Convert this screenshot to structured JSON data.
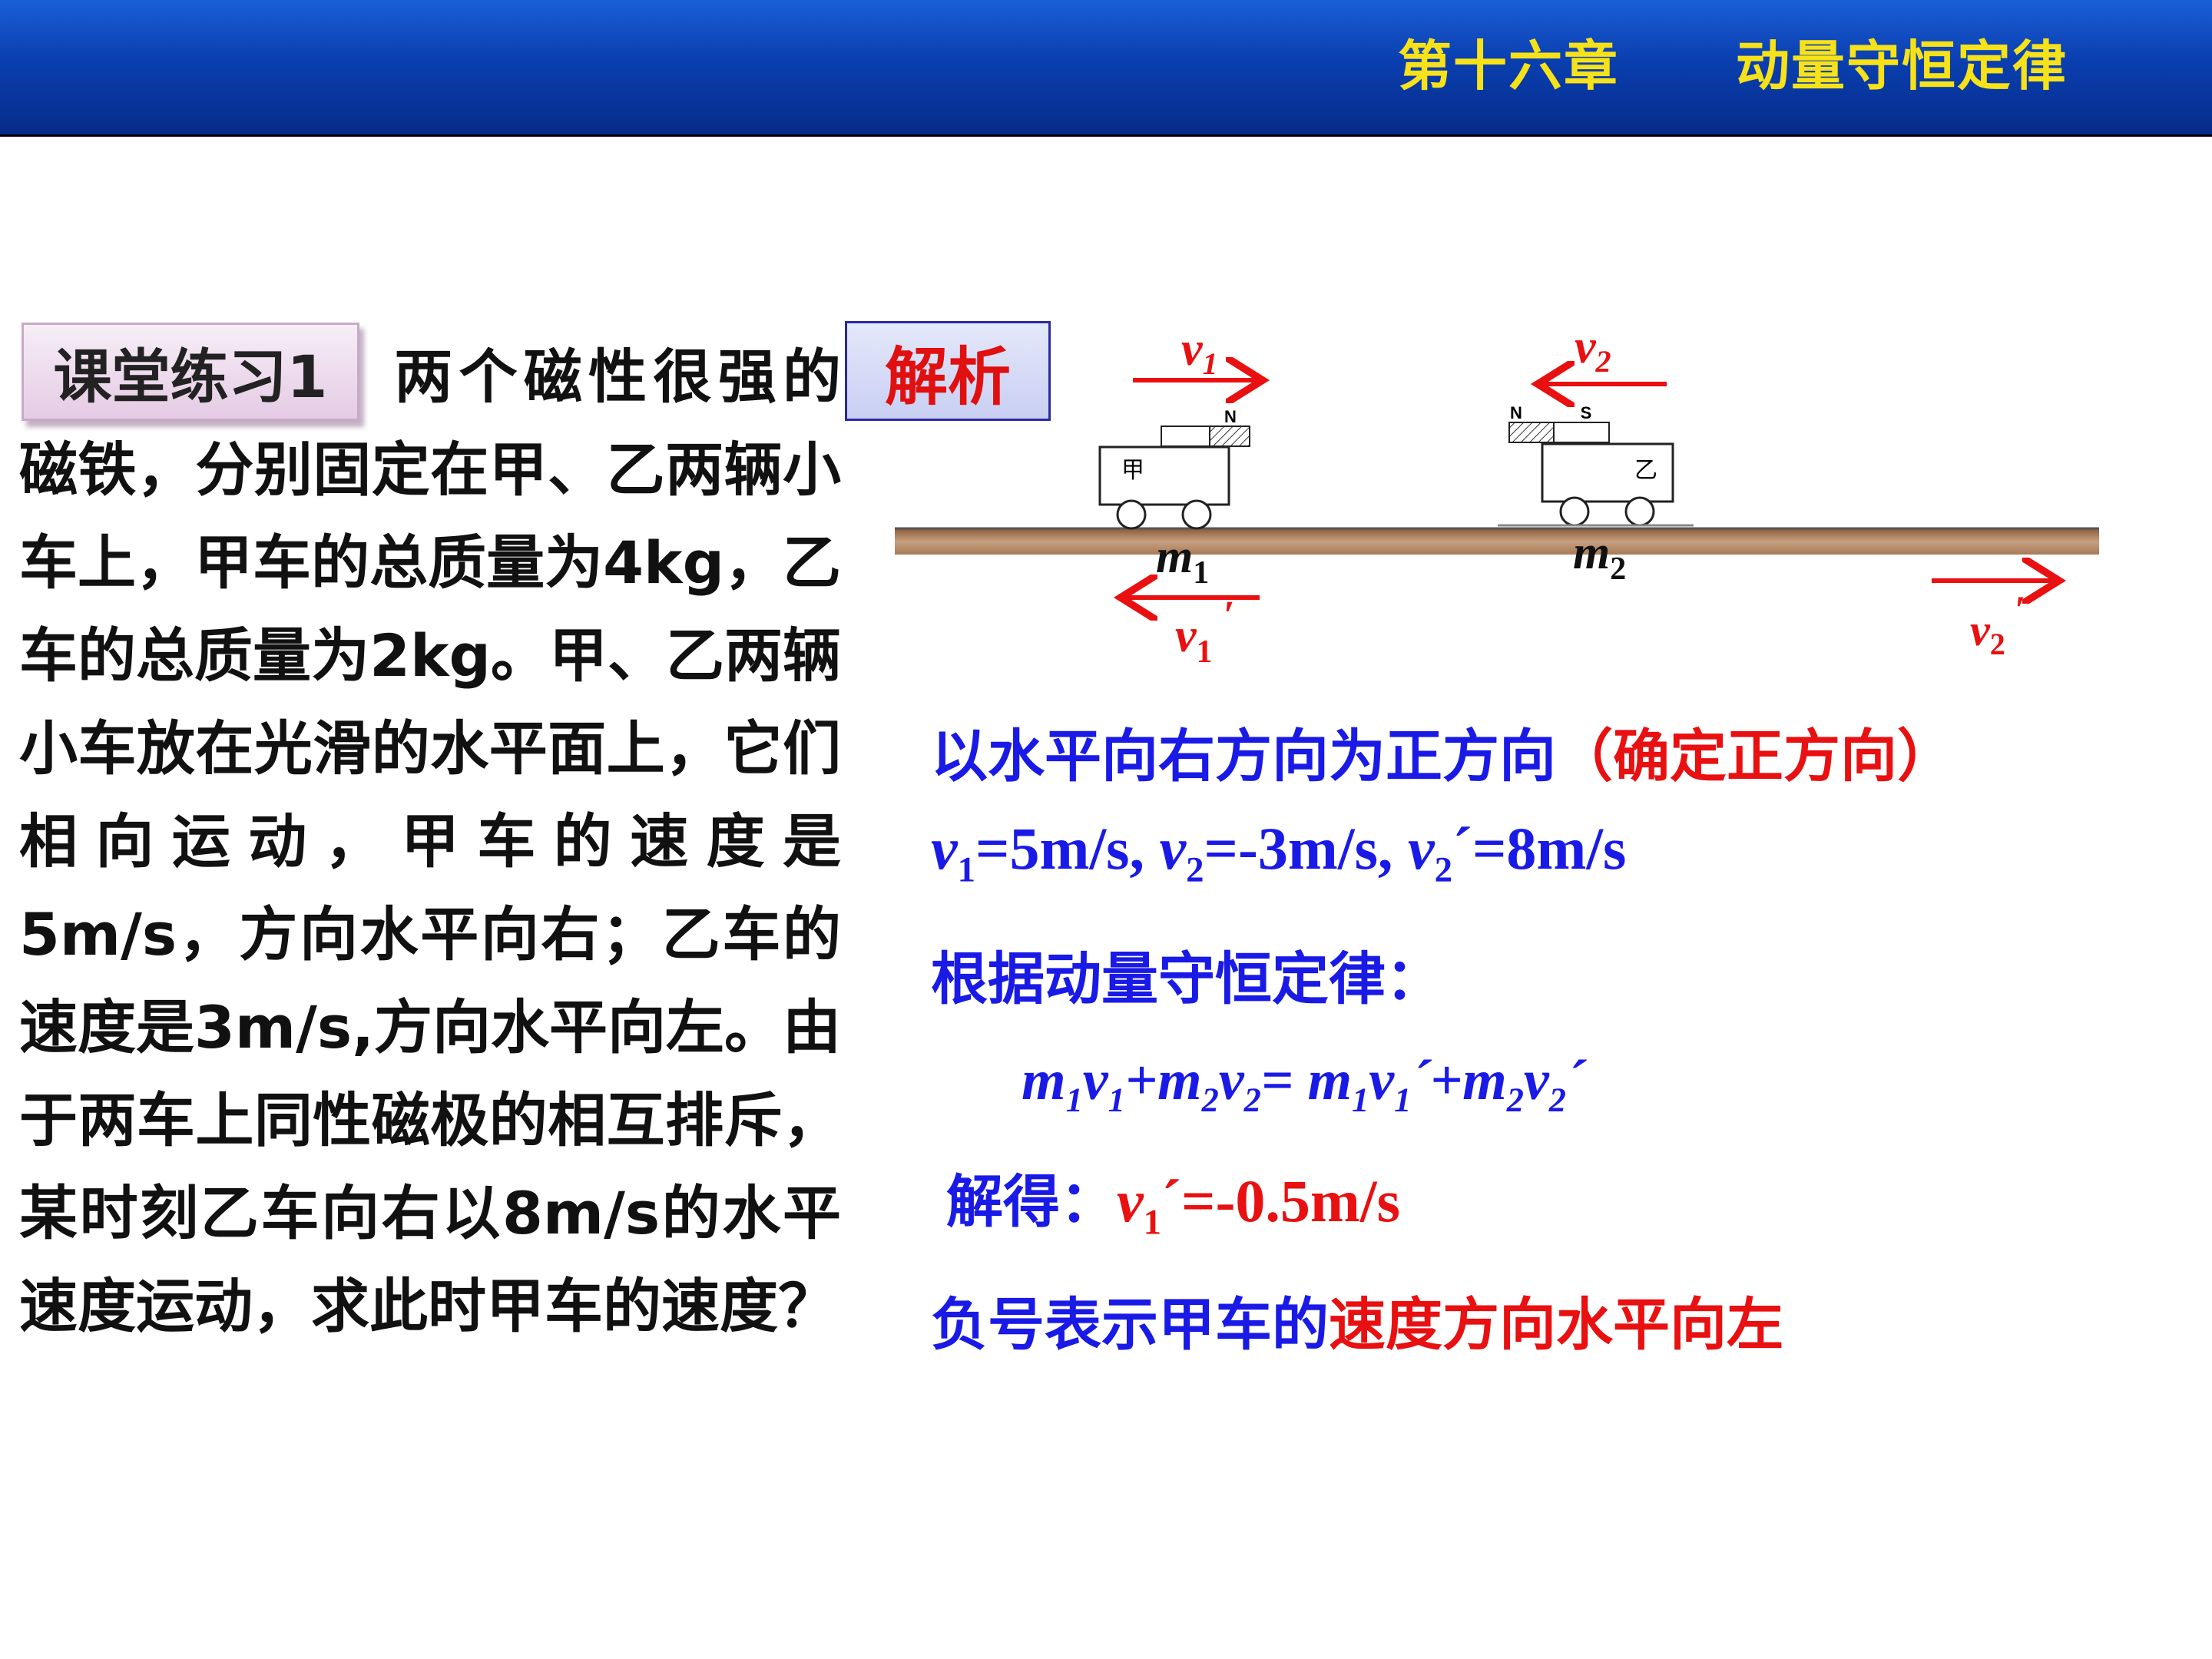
{
  "header": {
    "chapter": "第十六章",
    "topic": "动量守恒定律"
  },
  "exercise": {
    "tag": "课堂练习1",
    "text": "两个磁性很强的磁铁，分别固定在甲、乙两辆小车上，甲车的总质量为4kg，乙车的总质量为2kg。甲、乙两辆小车放在光滑的水平面上，它们相向运动，甲车的速度是5m/s，方向水平向右；乙车的速度是3m/s,方向水平向左。由于两车上同性磁极的相互排斥，某时刻乙车向右以8m/s的水平速度运动，求此时甲车的速度？"
  },
  "analysis": {
    "tag": "解析",
    "diagram": {
      "car1_label": "甲",
      "car2_label": "乙",
      "magnet1_pole": "N",
      "magnet2_poles": [
        "N",
        "S"
      ],
      "mass1": "m",
      "mass1_sub": "1",
      "mass2": "m",
      "mass2_sub": "2",
      "v1": "v",
      "v1_sub": "1",
      "v2": "v",
      "v2_sub": "2",
      "v1_after": "v",
      "v1_after_sub": "1",
      "v2_after": "v",
      "v2_after_sub": "2",
      "prime": "′"
    },
    "line1_blue": "以水平向右方向为正方向",
    "line1_red": "（确定正方向）",
    "line2": {
      "v1": "v",
      "v1_sub": "1",
      "v1_val": "=5m/s, ",
      "v2": "v",
      "v2_sub": "2",
      "v2_val": "=-3m/s, ",
      "v2p": "v",
      "v2p_sub": "2",
      "v2p_val": "´=8m/s"
    },
    "line3": "根据动量守恒定律：",
    "equation": {
      "t1": "m",
      "t1s": "1",
      "t2": "v",
      "t2s": "1",
      "plus1": "+",
      "t3": "m",
      "t3s": "2",
      "t4": "v",
      "t4s": "2",
      "eq": "= ",
      "t5": "m",
      "t5s": "1",
      "t6": "v",
      "t6s": "1",
      "p1": "´+",
      "t7": "m",
      "t7s": "2",
      "t8": "v",
      "t8s": "2",
      "p2": "´"
    },
    "result_label": "解得：",
    "result": {
      "v": "v",
      "sub": "1",
      "val": "´=-0.5m/s"
    },
    "conclusion_blue": "负号表示甲车的",
    "conclusion_red": "速度方向水平向左"
  },
  "colors": {
    "header_bg": "#0a3fb0",
    "header_text": "#f7e21a",
    "blue_text": "#1a1ae6",
    "red_text": "#e81010",
    "arrow": "#e81010"
  }
}
